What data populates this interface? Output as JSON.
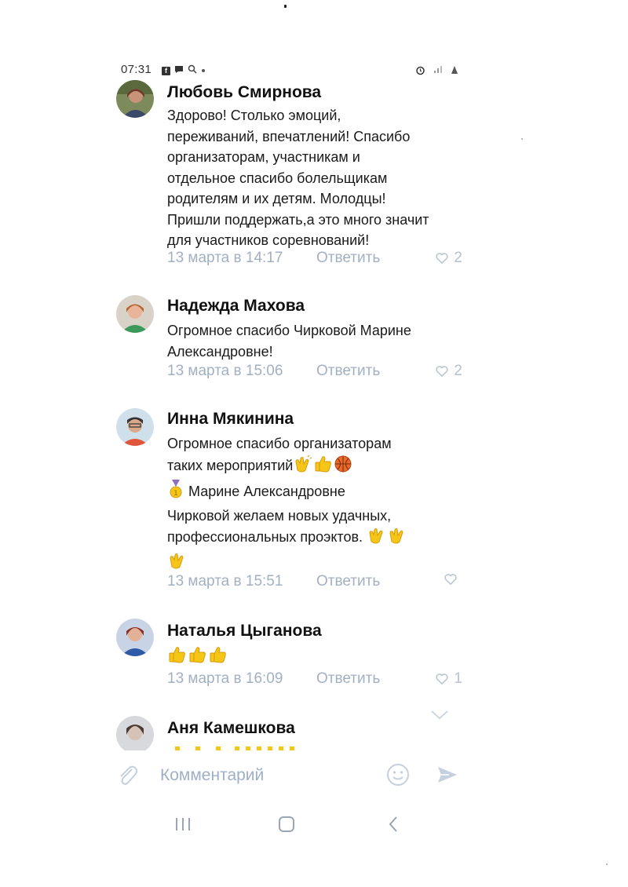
{
  "status_bar": {
    "time": "07:31",
    "icons_left": [
      "facebook-icon",
      "chat-icon",
      "search-icon",
      "dot-icon"
    ],
    "icons_right": [
      "alarm-icon",
      "signal-icon",
      "battery-icon"
    ]
  },
  "comments": [
    {
      "author": "Любовь Смирнова",
      "text": "Здорово! Столько эмоций,\nпереживаний, впечатлений! Спасибо\nорганизаторам, участникам и\nотдельное спасибо болельщикам\nродителям и их детям. Молодцы!\nПришли поддержать,а это много значит\nдля участников соревнований!",
      "date": "13 марта в 14:17",
      "reply": "Ответить",
      "likes": "2"
    },
    {
      "author": "Надежда Махова",
      "text": "Огромное спасибо Чирковой Марине\nАлександровне!",
      "date": "13 марта в 15:06",
      "reply": "Ответить",
      "likes": "2"
    },
    {
      "author": "Инна Мякинина",
      "text_line1": "Огромное спасибо организаторам",
      "text_line2": "таких мероприятий",
      "text_line3": "Марине Александровне",
      "text_line4": "Чирковой желаем новых удачных,",
      "text_line5": "профессиональных проэктов.",
      "emojis": [
        "clapping-hands-icon",
        "thumbs-up-icon",
        "basketball-icon",
        "medal-icon"
      ],
      "date": "13 марта в 15:51",
      "reply": "Ответить",
      "likes": ""
    },
    {
      "author": "Наталья Цыганова",
      "emojis": [
        "thumbs-up-icon",
        "thumbs-up-icon",
        "thumbs-up-icon"
      ],
      "date": "13 марта в 16:09",
      "reply": "Ответить",
      "likes": "1"
    },
    {
      "author": "Аня Камешкова"
    }
  ],
  "input": {
    "placeholder": "Комментарий"
  },
  "colors": {
    "meta": "#a3b0c2",
    "accent": "#9fb0c6",
    "emoji_yellow": "#f5c518",
    "basketball": "#e8692a"
  }
}
